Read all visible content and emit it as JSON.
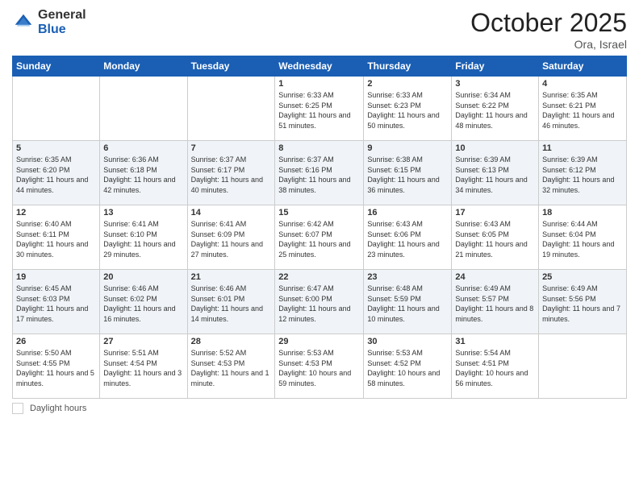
{
  "header": {
    "logo_general": "General",
    "logo_blue": "Blue",
    "month": "October 2025",
    "location": "Ora, Israel"
  },
  "days_of_week": [
    "Sunday",
    "Monday",
    "Tuesday",
    "Wednesday",
    "Thursday",
    "Friday",
    "Saturday"
  ],
  "weeks": [
    [
      {
        "day": "",
        "info": ""
      },
      {
        "day": "",
        "info": ""
      },
      {
        "day": "",
        "info": ""
      },
      {
        "day": "1",
        "info": "Sunrise: 6:33 AM\nSunset: 6:25 PM\nDaylight: 11 hours and 51 minutes."
      },
      {
        "day": "2",
        "info": "Sunrise: 6:33 AM\nSunset: 6:23 PM\nDaylight: 11 hours and 50 minutes."
      },
      {
        "day": "3",
        "info": "Sunrise: 6:34 AM\nSunset: 6:22 PM\nDaylight: 11 hours and 48 minutes."
      },
      {
        "day": "4",
        "info": "Sunrise: 6:35 AM\nSunset: 6:21 PM\nDaylight: 11 hours and 46 minutes."
      }
    ],
    [
      {
        "day": "5",
        "info": "Sunrise: 6:35 AM\nSunset: 6:20 PM\nDaylight: 11 hours and 44 minutes."
      },
      {
        "day": "6",
        "info": "Sunrise: 6:36 AM\nSunset: 6:18 PM\nDaylight: 11 hours and 42 minutes."
      },
      {
        "day": "7",
        "info": "Sunrise: 6:37 AM\nSunset: 6:17 PM\nDaylight: 11 hours and 40 minutes."
      },
      {
        "day": "8",
        "info": "Sunrise: 6:37 AM\nSunset: 6:16 PM\nDaylight: 11 hours and 38 minutes."
      },
      {
        "day": "9",
        "info": "Sunrise: 6:38 AM\nSunset: 6:15 PM\nDaylight: 11 hours and 36 minutes."
      },
      {
        "day": "10",
        "info": "Sunrise: 6:39 AM\nSunset: 6:13 PM\nDaylight: 11 hours and 34 minutes."
      },
      {
        "day": "11",
        "info": "Sunrise: 6:39 AM\nSunset: 6:12 PM\nDaylight: 11 hours and 32 minutes."
      }
    ],
    [
      {
        "day": "12",
        "info": "Sunrise: 6:40 AM\nSunset: 6:11 PM\nDaylight: 11 hours and 30 minutes."
      },
      {
        "day": "13",
        "info": "Sunrise: 6:41 AM\nSunset: 6:10 PM\nDaylight: 11 hours and 29 minutes."
      },
      {
        "day": "14",
        "info": "Sunrise: 6:41 AM\nSunset: 6:09 PM\nDaylight: 11 hours and 27 minutes."
      },
      {
        "day": "15",
        "info": "Sunrise: 6:42 AM\nSunset: 6:07 PM\nDaylight: 11 hours and 25 minutes."
      },
      {
        "day": "16",
        "info": "Sunrise: 6:43 AM\nSunset: 6:06 PM\nDaylight: 11 hours and 23 minutes."
      },
      {
        "day": "17",
        "info": "Sunrise: 6:43 AM\nSunset: 6:05 PM\nDaylight: 11 hours and 21 minutes."
      },
      {
        "day": "18",
        "info": "Sunrise: 6:44 AM\nSunset: 6:04 PM\nDaylight: 11 hours and 19 minutes."
      }
    ],
    [
      {
        "day": "19",
        "info": "Sunrise: 6:45 AM\nSunset: 6:03 PM\nDaylight: 11 hours and 17 minutes."
      },
      {
        "day": "20",
        "info": "Sunrise: 6:46 AM\nSunset: 6:02 PM\nDaylight: 11 hours and 16 minutes."
      },
      {
        "day": "21",
        "info": "Sunrise: 6:46 AM\nSunset: 6:01 PM\nDaylight: 11 hours and 14 minutes."
      },
      {
        "day": "22",
        "info": "Sunrise: 6:47 AM\nSunset: 6:00 PM\nDaylight: 11 hours and 12 minutes."
      },
      {
        "day": "23",
        "info": "Sunrise: 6:48 AM\nSunset: 5:59 PM\nDaylight: 11 hours and 10 minutes."
      },
      {
        "day": "24",
        "info": "Sunrise: 6:49 AM\nSunset: 5:57 PM\nDaylight: 11 hours and 8 minutes."
      },
      {
        "day": "25",
        "info": "Sunrise: 6:49 AM\nSunset: 5:56 PM\nDaylight: 11 hours and 7 minutes."
      }
    ],
    [
      {
        "day": "26",
        "info": "Sunrise: 5:50 AM\nSunset: 4:55 PM\nDaylight: 11 hours and 5 minutes."
      },
      {
        "day": "27",
        "info": "Sunrise: 5:51 AM\nSunset: 4:54 PM\nDaylight: 11 hours and 3 minutes."
      },
      {
        "day": "28",
        "info": "Sunrise: 5:52 AM\nSunset: 4:53 PM\nDaylight: 11 hours and 1 minute."
      },
      {
        "day": "29",
        "info": "Sunrise: 5:53 AM\nSunset: 4:53 PM\nDaylight: 10 hours and 59 minutes."
      },
      {
        "day": "30",
        "info": "Sunrise: 5:53 AM\nSunset: 4:52 PM\nDaylight: 10 hours and 58 minutes."
      },
      {
        "day": "31",
        "info": "Sunrise: 5:54 AM\nSunset: 4:51 PM\nDaylight: 10 hours and 56 minutes."
      },
      {
        "day": "",
        "info": ""
      }
    ]
  ],
  "footer": {
    "label": "Daylight hours"
  }
}
